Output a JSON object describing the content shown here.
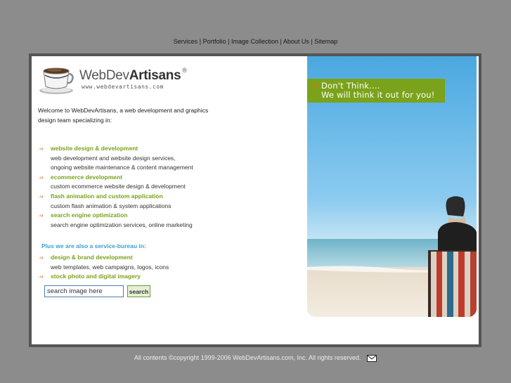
{
  "nav": {
    "items": [
      "Services",
      "Portfolio",
      "Image Collection",
      "About Us",
      "Sitemap"
    ],
    "separator": "|"
  },
  "logo": {
    "brand_light": "WebDev",
    "brand_bold": "Artisans",
    "registered": "®",
    "url": "www.webdevartisans.com"
  },
  "intro": "Welcome to WebDevArtisans, a web development and graphics design team specializing in:",
  "services": [
    {
      "title": "website design & development",
      "desc": [
        "web development and website design services,",
        "ongoing website maintenance & content management"
      ]
    },
    {
      "title": "ecommerce development",
      "desc": [
        "custom ecommerce website design & development"
      ]
    },
    {
      "title": "flash animation and custom application",
      "desc": [
        "custom flash animation & system applications"
      ]
    },
    {
      "title": "search engine optimization",
      "desc": [
        "search engine optimization services, online marketing"
      ]
    }
  ],
  "bureau": {
    "heading": "Plus we are also a service-bureau in:",
    "items": [
      {
        "title": "design & brand development",
        "desc": [
          "web templates, web campaigns, logos, icons"
        ]
      },
      {
        "title": "stock photo and digital imagery",
        "desc": []
      }
    ]
  },
  "search": {
    "value": "search image here",
    "button": "search"
  },
  "banner": {
    "line1": "Don't Think....",
    "line2": "We will think it out for you!"
  },
  "footer": {
    "text": "All contents ©copyright 1999-2006 WebDevArtisans.com, Inc. All rights reserved."
  },
  "icons": {
    "arrow": "arrow-icon",
    "mail": "mail-icon",
    "cup": "coffee-cup-icon"
  },
  "colors": {
    "background": "#8c8c8c",
    "accent_green": "#7aa21a",
    "accent_blue": "#3ba0d6",
    "arrow_orange": "#e05a00"
  }
}
